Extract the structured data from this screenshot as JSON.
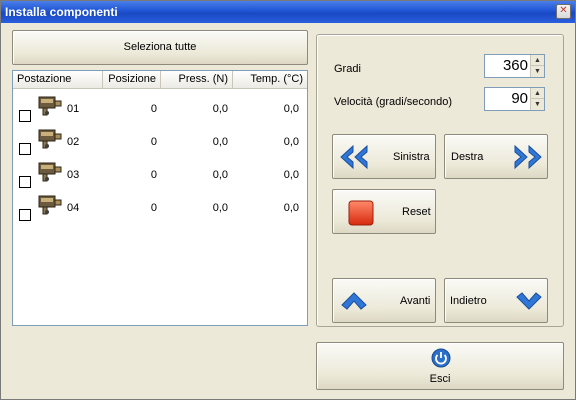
{
  "window": {
    "title": "Installa componenti",
    "close_glyph": "✕"
  },
  "left": {
    "select_all_label": "Seleziona tutte",
    "columns": [
      "Postazione",
      "Posizione",
      "Press. (N)",
      "Temp. (°C)"
    ],
    "rows": [
      {
        "postazione": "01",
        "posizione": "0",
        "pressione": "0,0",
        "temperatura": "0,0",
        "checked": false
      },
      {
        "postazione": "02",
        "posizione": "0",
        "pressione": "0,0",
        "temperatura": "0,0",
        "checked": false
      },
      {
        "postazione": "03",
        "posizione": "0",
        "pressione": "0,0",
        "temperatura": "0,0",
        "checked": false
      },
      {
        "postazione": "04",
        "posizione": "0",
        "pressione": "0,0",
        "temperatura": "0,0",
        "checked": false
      }
    ]
  },
  "right": {
    "gradi_label": "Gradi",
    "gradi_value": "360",
    "velocita_label": "Velocità (gradi/secondo)",
    "velocita_value": "90",
    "sinistra_label": "Sinistra",
    "destra_label": "Destra",
    "reset_label": "Reset",
    "avanti_label": "Avanti",
    "indietro_label": "Indietro",
    "esci_label": "Esci",
    "icons": {
      "left": "double-chevron-left-icon",
      "right": "double-chevron-right-icon",
      "reset": "red-square-stop-icon",
      "up": "chevron-up-icon",
      "down": "chevron-down-icon",
      "exit": "power-icon"
    }
  },
  "colors": {
    "title_bar": "#1f55d6",
    "arrow_blue": "#2f76d6",
    "reset_red": "#e53b1f",
    "exit_blue": "#2a6fc9",
    "window_bg": "#ece9d8"
  }
}
